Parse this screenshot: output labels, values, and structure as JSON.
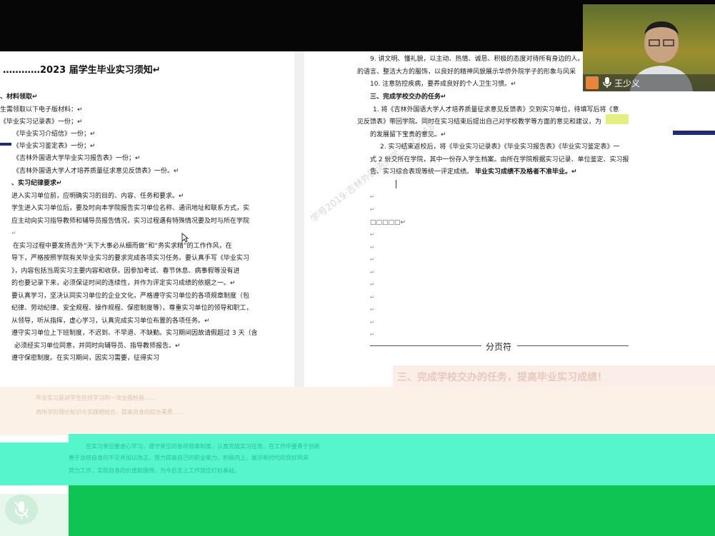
{
  "document": {
    "title": "…………2023 届学生毕业实习须知↵",
    "left_lines": [
      "、材料领取↵",
      "生需领取以下电子版材料：↵",
      "《毕业实习记录表》一份；↵",
      "《毕业实习介绍信》一份；↵",
      "《毕业实习鉴定表》一份；↵",
      "《吉林外国语大学毕业实习报告表》一份；↵",
      "《吉林外国语大学人才培养质量征求意见反馈表》一份。↵",
      "、实习纪律要求↵",
      "进入实习单位前，应明确实习的目的、内容、任务和要求。↵",
      "学生进入实习单位后，要及时向本学院报告实习单位名称、通讯地址和联系方式，实",
      "应主动向实习指导教师和辅导员报告情况，实习过程遇有特殊情况要及时与所在学院",
      "↵",
      "在实习过程中要发扬吉外“天下大事必从细而做”和“务实求精”的工作作风，在",
      "导下，严格按照学院有关毕业实习的要求完成各项实习任务。要认真手写《毕业实习",
      "》，内容包括当周实习主要内容和收获。因参加考试、春节休息、病事假等没有进",
      "的也要记录下来，必须保证时间的连续性，并作为评定实习成绩的依据之一。↵",
      "要认真学习，坚决认同实习单位的企业文化，严格遵守实习单位的各项规章制度（包",
      "纪律、劳动纪律、安全规程、操作规程、保密制度等）。尊重实习单位的领导和职工，",
      "从领导，听从指挥，虚心学习，认真完成实习单位布置的各项任务。↵",
      "遵守实习单位上下班制度，不迟到、不早退、不缺勤。实习期间因故请假超过 3 天（含",
      "必须经实习单位同意，并同时向辅导员、指导教师报告。↵",
      "遵守保密制度。在实习期间，因实习需要，征得实习"
    ],
    "right_lines": [
      "9. 讲文明、懂礼貌，以主动、热情、诚恳、积极的态度对待所有身边的人。",
      "的语言、整洁大方的服饰，以良好的精神风貌展示华侨外院学子的形象与风采",
      "10. 注意防控疾病，要养成良好的个人卫生习惯。↵",
      "三、完成学校交办的任务↵",
      "1. 将《吉林外国语大学人才培养质量征求意见反馈表》交到实习单位，待填写后将《意",
      "见反馈表》带回学院。同时在实习结束后提出自己对学校教学等方面的意见和建议，为",
      "的发展留下宝贵的意见。↵",
      "2. 实习结束返校后，将《毕业实习记录表》《毕业实习报告表》《毕业实习鉴定表》一",
      "式 2 份交所在学院，其中一份存入学生档案。由所在学院根据实习记录、单位鉴定、实习报",
      "告、实习综合表现等统一评定成绩。",
      "毕业实习成绩不及格者不准毕业。↵",
      "□□□□□↵",
      "分页符"
    ],
    "empty_mark": "↵"
  },
  "overlay": {
    "banner": "三、完成学校交办的任务，提高毕业实习成绩！",
    "faint_lines": [
      "毕业实习是对学生在校学习的一次全面检验……",
      "将所学的理论知识与实践相结合，提高自身的综合素质……"
    ],
    "teal_lines": [
      "在实习单位要虚心学习，遵守单位的各项规章制度，认真完成实习任务，在工作中要勇于创新",
      "善于总结自身的不足并加以改正，努力提高自己的职业能力，积极向上，展示新时代的良好风采",
      "努力工作，实现自身的价值和理想，为今后走上工作岗位打好基础。"
    ]
  },
  "participant": {
    "name": "王少义"
  },
  "watermark": "学号2019·吉林外国语大学 1173518"
}
